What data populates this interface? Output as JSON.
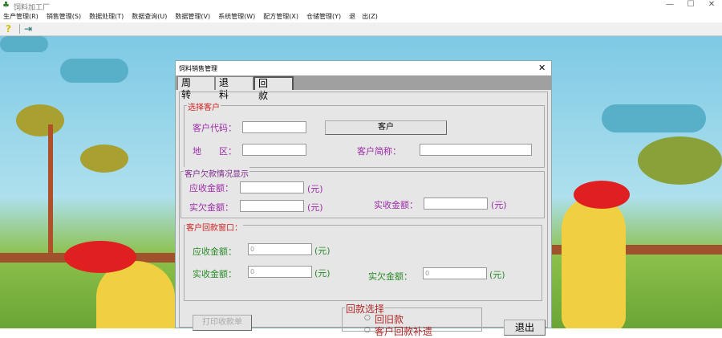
{
  "app": {
    "title": "饲料加工厂"
  },
  "window_controls": {
    "minimize": "—",
    "maximize": "☐",
    "close": "✕"
  },
  "menu": [
    "生产管理(R)",
    "销售管理(S)",
    "数据处理(T)",
    "数据查询(U)",
    "数据管理(V)",
    "系统管理(W)",
    "配方管理(X)",
    "仓储管理(Y)",
    "退　出(Z)"
  ],
  "dialog": {
    "title": "饲料销售管理",
    "close": "✕",
    "tabs": [
      "周转",
      "退料",
      "回款"
    ],
    "select_customer": {
      "legend": "选择客户",
      "code_label": "客户代码：",
      "code_value": "",
      "customer_button": "客户",
      "region_label": "地　　区：",
      "region_value": "",
      "short_name_label": "客户简称：",
      "short_name_value": ""
    },
    "debt": {
      "legend": "客户欠款情况显示",
      "receivable_label": "应收金额：",
      "receivable_value": "",
      "owed_label": "实欠金额：",
      "owed_value": "",
      "received_label": "实收金额：",
      "received_value": "",
      "unit": "(元)"
    },
    "payment": {
      "legend": "客户回款窗口：",
      "receivable_label": "应收金额：",
      "receivable_value": "0",
      "received_label": "实收金额：",
      "received_value": "0",
      "owed_label": "实欠金额：",
      "owed_value": "0",
      "unit": "(元)"
    },
    "print_button": "打印收款单",
    "payment_choice": {
      "legend": "回款选择",
      "options": [
        "回旧款",
        "客户回款补遗"
      ]
    },
    "exit_button": "退出"
  }
}
